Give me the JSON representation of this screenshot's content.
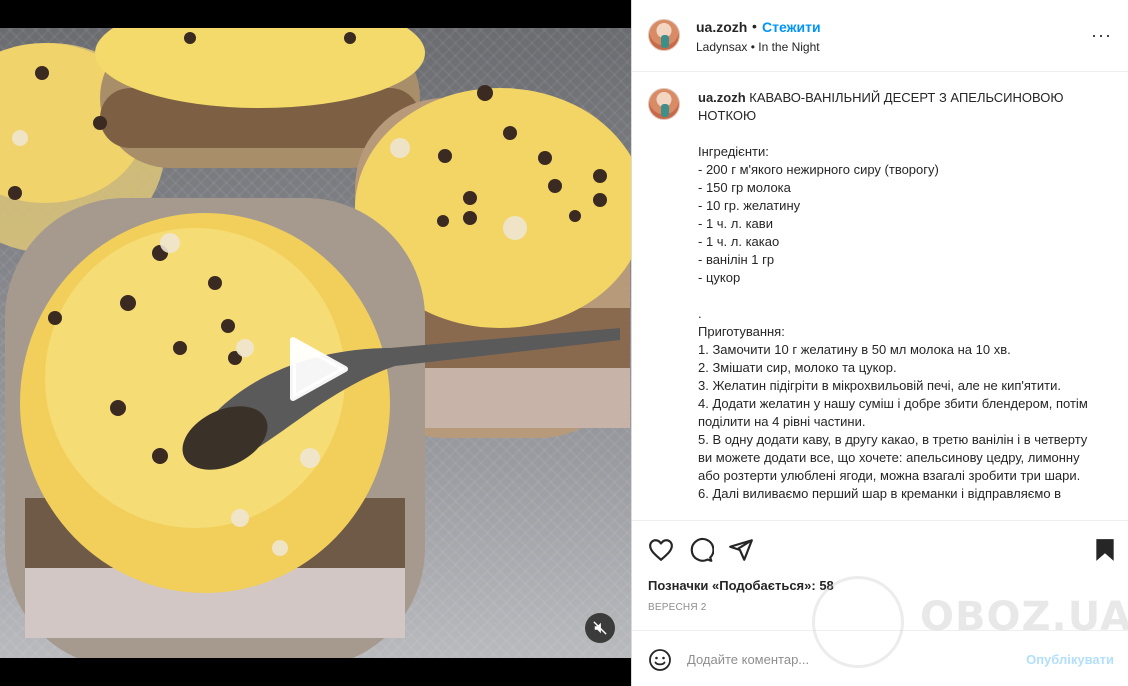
{
  "post": {
    "username": "ua.zozh",
    "separator": "•",
    "follow_label": "Стежити",
    "audio": "Ladynsax • In the Night",
    "more_label": "···"
  },
  "caption": {
    "username": "ua.zozh",
    "text": "КАВАВО-ВАНІЛЬНИЙ ДЕСЕРТ З АПЕЛЬСИНОВОЮ НОТКОЮ\n\nІнгредієнти:\n- 200 г м'якого нежирного сиру (творогу)\n- 150 гр молока\n- 10 гр. желатину\n- 1 ч. л. кави\n- 1 ч. л. какао\n- ванілін 1 гр\n- цукор\n\n.\nПриготування:\n1. Замочити 10 г желатину в 50 мл молока на 10 хв.\n2. Змішати сир, молоко та цукор.\n3. Желатин підігріти в мікрохвильовій печі, але не кип'ятити.\n4. Додати желатин у нашу суміш і добре збити блендером, потім поділити на 4 рівні частини.\n5. В одну додати каву, в другу какао, в третю ванілін і в четверту ви можете додати все, що хочете: апельсинову цедру, лимонну або розтерти улюблені ягоди, можна взагалі зробити три шари.\n6. Далі виливаємо перший шар в креманки і відправляємо в"
  },
  "likes": {
    "label": "Позначки «Подобається»:",
    "count": "58"
  },
  "date": "ВЕРЕСНЯ 2",
  "comment": {
    "placeholder": "Додайте коментар...",
    "publish_label": "Опублікувати"
  },
  "watermark": {
    "text": "OBOZ.UA"
  },
  "icons": {
    "like": "heart-icon",
    "comment": "comment-icon",
    "share": "send-icon",
    "save": "bookmark-icon",
    "emoji": "smiley-icon",
    "mute": "speaker-muted-icon",
    "play": "play-icon",
    "more": "more-icon"
  },
  "colors": {
    "accent": "#0095f6",
    "publish_disabled": "#b2dffc"
  }
}
